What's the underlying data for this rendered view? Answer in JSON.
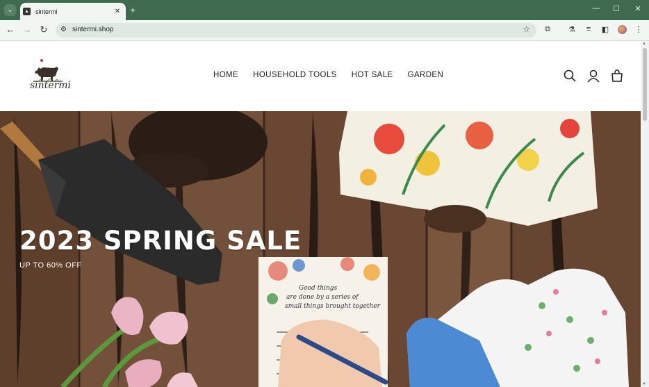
{
  "browser": {
    "tab_title": "sintermi",
    "url": "sintermi.shop",
    "favicon_icon": "site-favicon",
    "new_tab_icon": "plus-icon"
  },
  "site": {
    "logo_text": "sintermi",
    "nav": [
      "HOME",
      "HOUSEHOLD TOOLS",
      "HOT SALE",
      "GARDEN"
    ],
    "header_icons": [
      "search-icon",
      "account-icon",
      "cart-icon"
    ]
  },
  "hero": {
    "title": "2023 SPRING SALE",
    "subtitle": "UP TO 60% OFF",
    "notepad_text": [
      "Good things",
      "are done by a series of",
      "small things brought together"
    ]
  }
}
